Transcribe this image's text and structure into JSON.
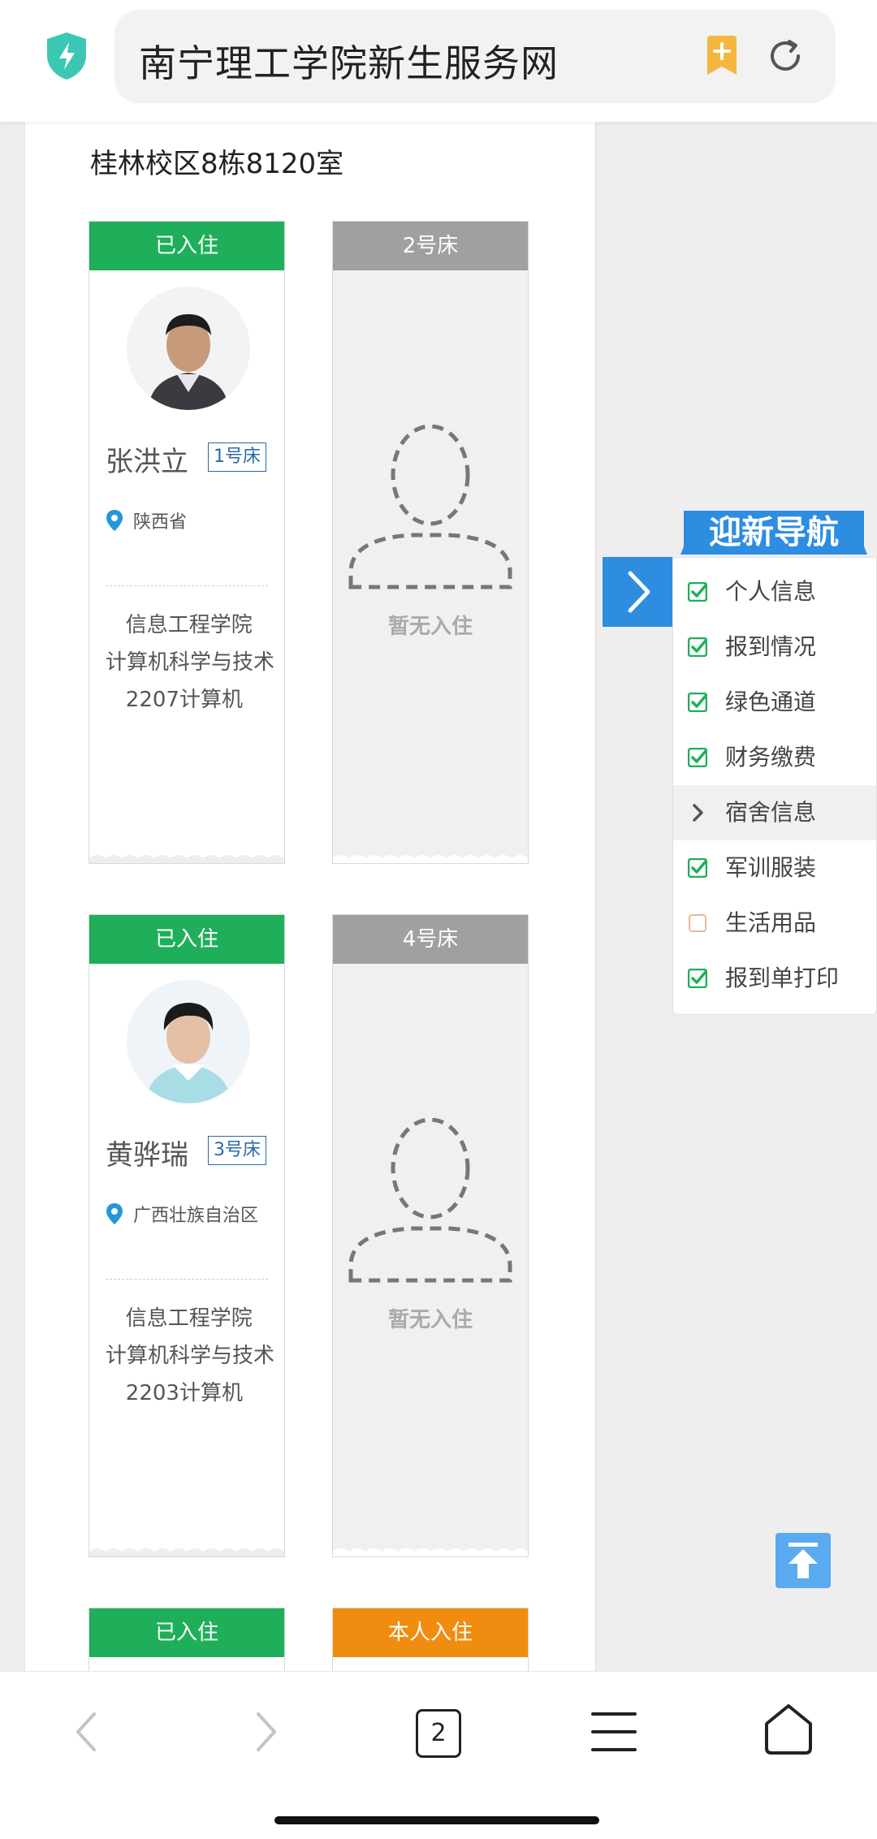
{
  "browser": {
    "title": "南宁理工学院新生服务网",
    "tab_count": "2"
  },
  "room": {
    "title": "桂林校区8栋8120室"
  },
  "beds": [
    {
      "status": "已入住",
      "name": "张洪立",
      "bed_tag": "1号床",
      "location": "陕西省",
      "info": "   信息工程学院      计算机科学与技术\n   2207计算机"
    },
    {
      "status": "2号床",
      "empty_text": "暂无入住"
    },
    {
      "status": "已入住",
      "name": "黄骅瑞",
      "bed_tag": "3号床",
      "location": "广西壮族自治区",
      "info": "   信息工程学院      计算机科学与技术\n   2203计算机"
    },
    {
      "status": "4号床",
      "empty_text": "暂无入住"
    },
    {
      "status": "已入住"
    },
    {
      "status": "本人入住"
    }
  ],
  "nav": {
    "title": "迎新导航",
    "items": [
      {
        "label": "个人信息",
        "state": "done"
      },
      {
        "label": "报到情况",
        "state": "done"
      },
      {
        "label": "绿色通道",
        "state": "done"
      },
      {
        "label": "财务缴费",
        "state": "done"
      },
      {
        "label": "宿舍信息",
        "state": "current"
      },
      {
        "label": "军训服装",
        "state": "done"
      },
      {
        "label": "生活用品",
        "state": "pending"
      },
      {
        "label": "报到单打印",
        "state": "done"
      }
    ]
  },
  "colors": {
    "green": "#1faf5a",
    "gray": "#a0a0a0",
    "orange": "#f08c0f",
    "nav_blue": "#2d8de0",
    "tag_blue": "#2b6aa6"
  }
}
